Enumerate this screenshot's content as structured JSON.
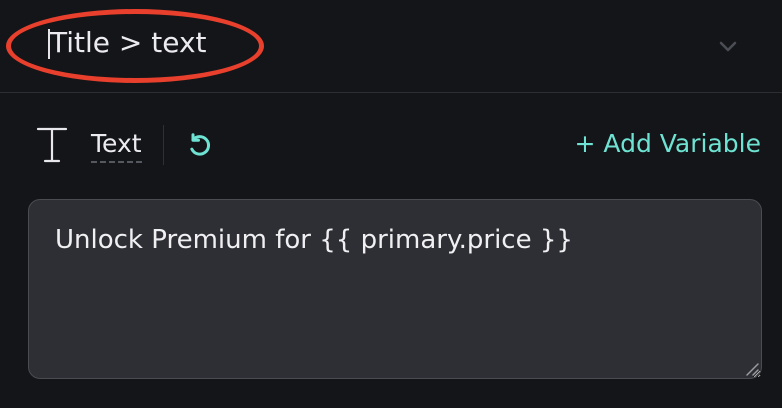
{
  "header": {
    "title": "Title > text",
    "icons": {
      "collapse": "chevron-down-icon"
    }
  },
  "toolbar": {
    "type_label": "Text",
    "add_variable_label": "+ Add Variable",
    "icons": {
      "type": "text-type-icon",
      "reset": "reset-icon"
    }
  },
  "editor": {
    "value": "Unlock Premium for {{ primary.price }}"
  },
  "colors": {
    "background": "#141518",
    "highlight": "#e8402d",
    "accent": "#6fe3d3",
    "editor_background": "#2e2f34"
  }
}
